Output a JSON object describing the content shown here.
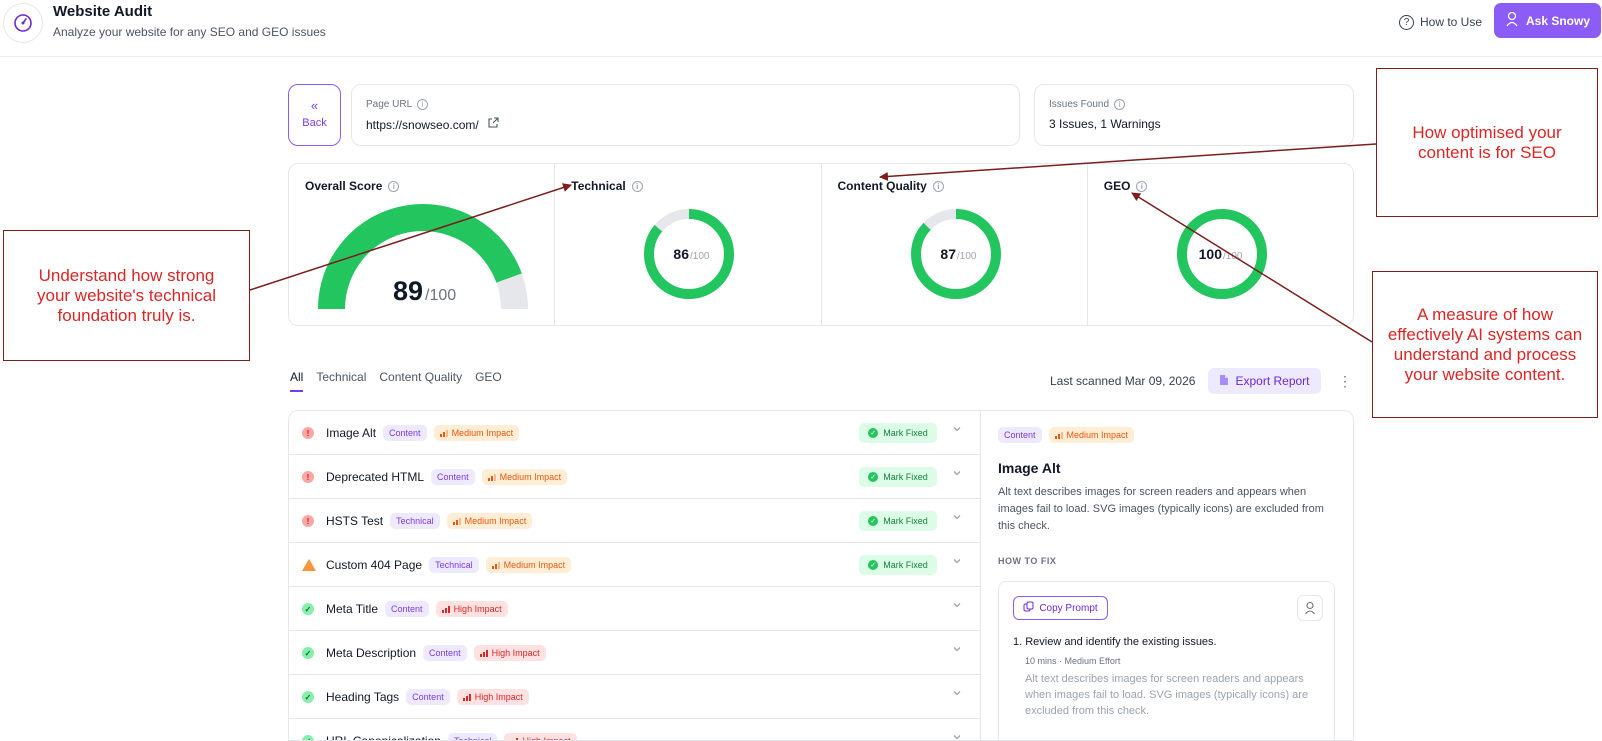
{
  "header": {
    "title": "Website Audit",
    "subtitle": "Analyze your website for any SEO and GEO issues",
    "how_to_use": "How to Use",
    "ask_button": "Ask Snowy"
  },
  "back": {
    "label": "Back"
  },
  "page_url": {
    "label": "Page URL",
    "value": "https://snowseo.com/"
  },
  "issues_found": {
    "label": "Issues Found",
    "value": "3 Issues, 1 Warnings"
  },
  "scores": {
    "overall": {
      "label": "Overall Score",
      "value": "89",
      "max": "/100",
      "fraction": 0.89
    },
    "technical": {
      "label": "Technical",
      "value": "86",
      "max": "/100",
      "fraction": 0.86
    },
    "content_quality": {
      "label": "Content Quality",
      "value": "87",
      "max": "/100",
      "fraction": 0.87
    },
    "geo": {
      "label": "GEO",
      "value": "100",
      "max": "/100",
      "fraction": 1.0
    }
  },
  "tabs": [
    "All",
    "Technical",
    "Content Quality",
    "GEO"
  ],
  "toolbar": {
    "last_scanned": "Last scanned Mar 09, 2026",
    "export": "Export Report"
  },
  "issues": [
    {
      "name": "Image Alt",
      "type": "Content",
      "impact": "Medium Impact",
      "status": "error",
      "fixed": "Mark Fixed"
    },
    {
      "name": "Deprecated HTML",
      "type": "Content",
      "impact": "Medium Impact",
      "status": "error",
      "fixed": "Mark Fixed"
    },
    {
      "name": "HSTS Test",
      "type": "Technical",
      "impact": "Medium Impact",
      "status": "error",
      "fixed": "Mark Fixed"
    },
    {
      "name": "Custom 404 Page",
      "type": "Technical",
      "impact": "Medium Impact",
      "status": "warn",
      "fixed": "Mark Fixed"
    },
    {
      "name": "Meta Title",
      "type": "Content",
      "impact": "High Impact",
      "status": "ok",
      "fixed": ""
    },
    {
      "name": "Meta Description",
      "type": "Content",
      "impact": "High Impact",
      "status": "ok",
      "fixed": ""
    },
    {
      "name": "Heading Tags",
      "type": "Content",
      "impact": "High Impact",
      "status": "ok",
      "fixed": ""
    },
    {
      "name": "URL Canonicalization",
      "type": "Technical",
      "impact": "High Impact",
      "status": "ok",
      "fixed": ""
    }
  ],
  "detail": {
    "type": "Content",
    "impact": "Medium Impact",
    "title": "Image Alt",
    "description": "Alt text describes images for screen readers and appears when images fail to load. SVG images (typically icons) are excluded from this check.",
    "how_to_fix": "HOW TO FIX",
    "copy_prompt": "Copy Prompt",
    "step_title": "1.  Review and identify the existing issues.",
    "step_meta": "10 mins · Medium Effort",
    "step_desc": "Alt text describes images for screen readers and appears when images fail to load. SVG images (typically icons) are excluded from this check."
  },
  "annotations": {
    "technical": "Understand how strong your website's technical foundation truly is.",
    "content": "How optimised your content is for SEO",
    "geo": "A measure of how effectively AI systems can understand and process your website content."
  },
  "colors": {
    "accent": "#8b5cf6",
    "score_green": "#22c55e",
    "track_gray": "#e5e7eb",
    "annotation_red": "#dc2626",
    "annotation_border": "#7f1d1d"
  }
}
